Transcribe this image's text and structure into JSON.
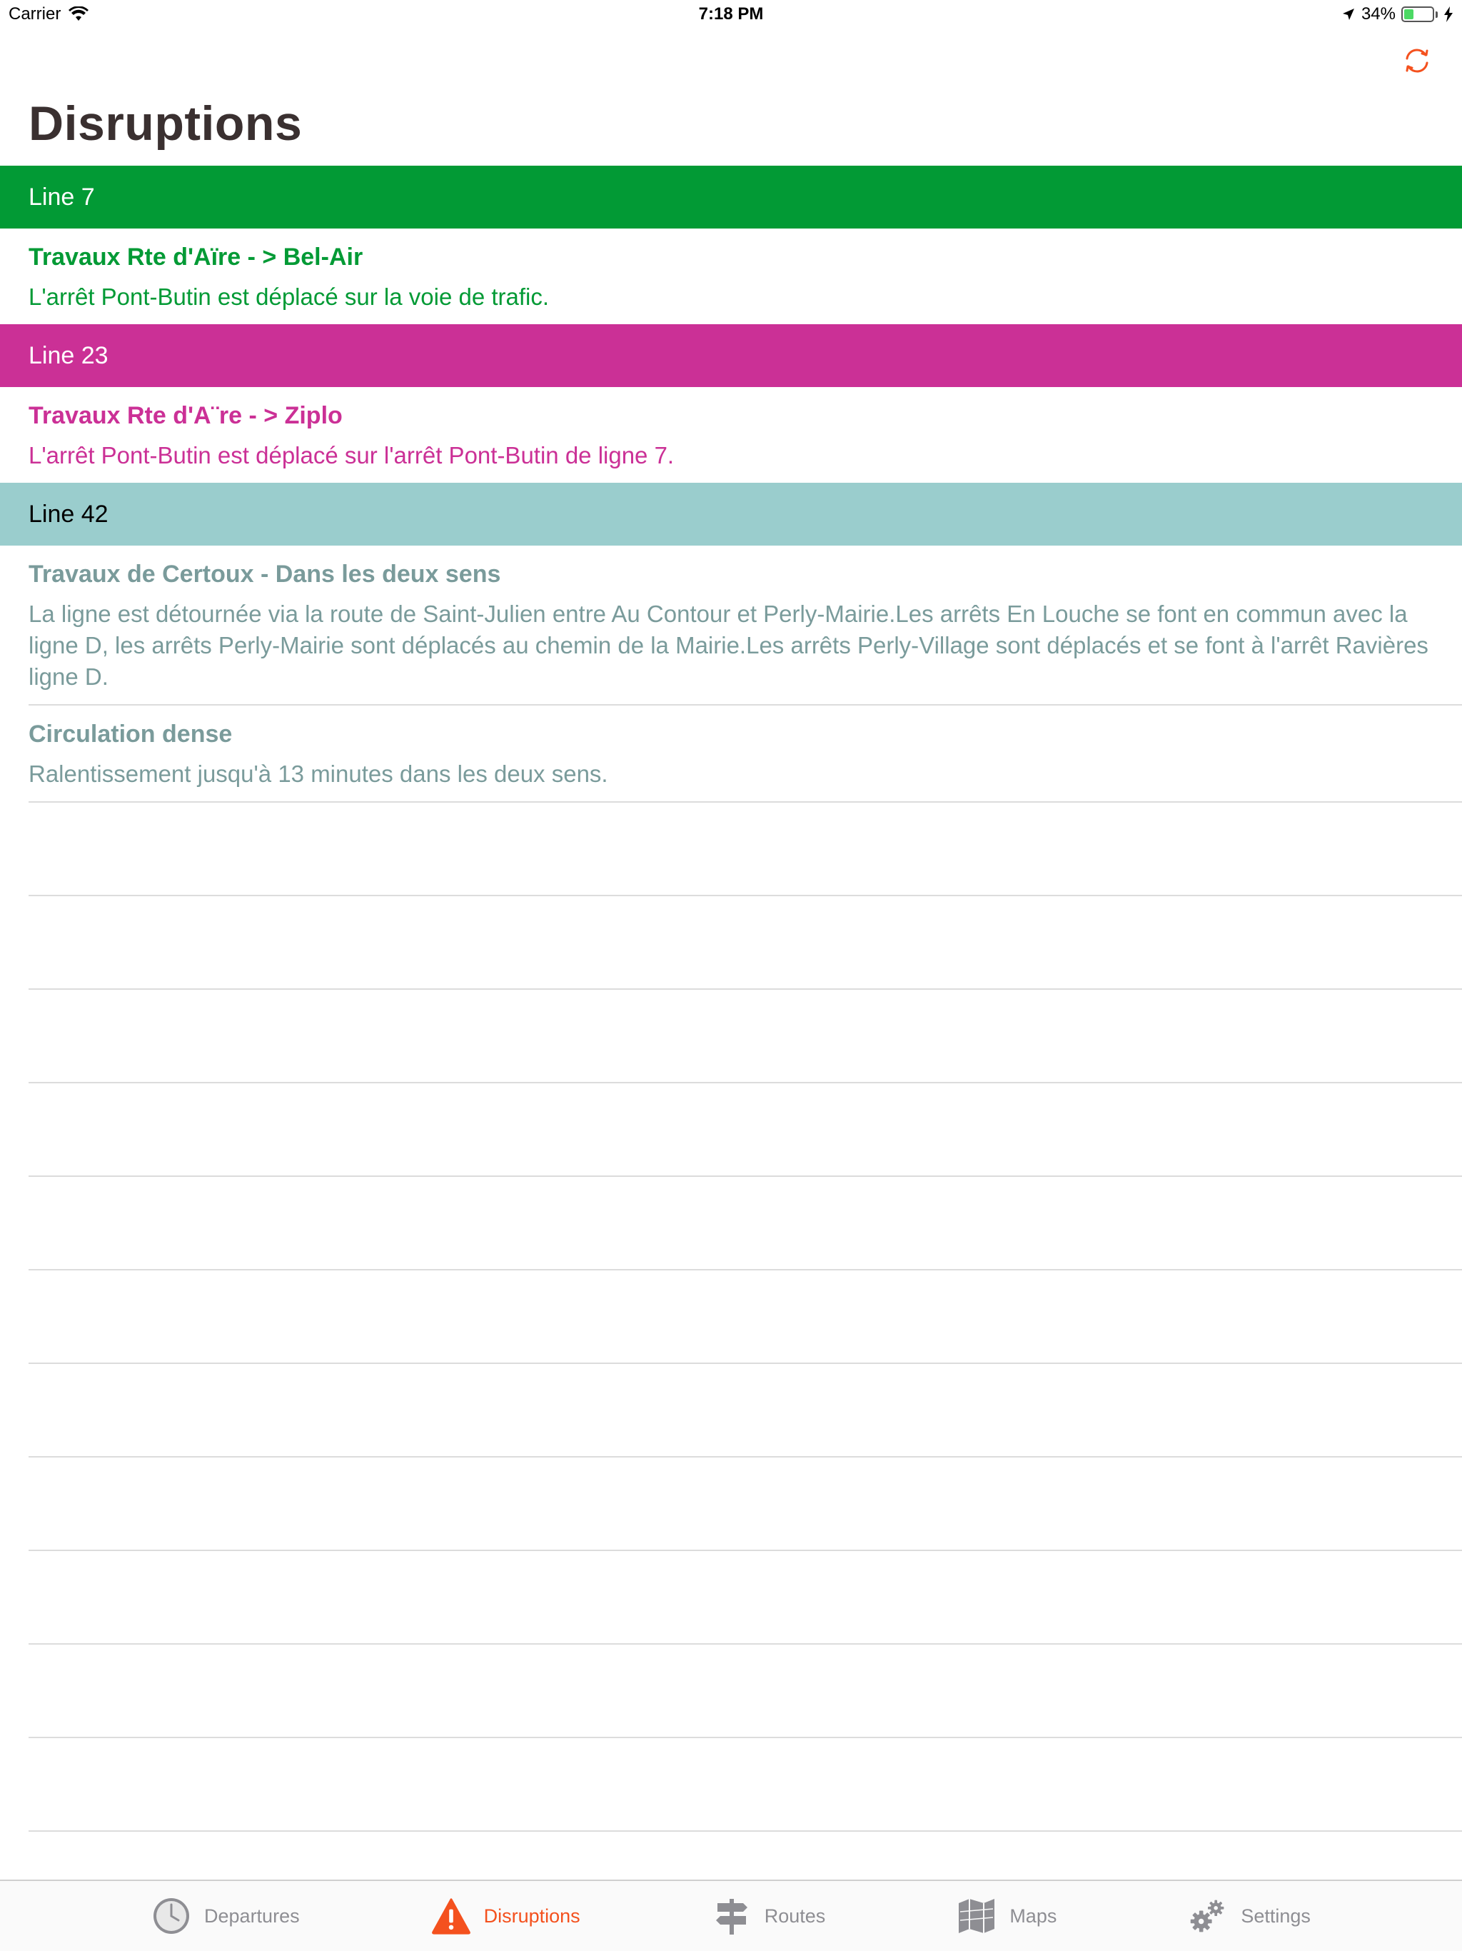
{
  "status_bar": {
    "carrier": "Carrier",
    "time": "7:18 PM",
    "battery": "34%",
    "battery_level": 0.34
  },
  "nav": {
    "title": "Disruptions",
    "accent_color": "#f4511e"
  },
  "sections": [
    {
      "line": "Line 7",
      "header_bg": "#029A35",
      "header_fg": "#ffffff",
      "text_color": "#029A35",
      "items": [
        {
          "title": "Travaux Rte d'Aïre - > Bel-Air",
          "body": "L'arrêt Pont-Butin est déplacé sur la voie de trafic."
        }
      ]
    },
    {
      "line": "Line 23",
      "header_bg": "#CB3096",
      "header_fg": "#ffffff",
      "text_color": "#CB3096",
      "items": [
        {
          "title": "Travaux Rte d'A¨re - > Ziplo",
          "body": "L'arrêt Pont-Butin est déplacé sur l'arrêt Pont-Butin de ligne 7."
        }
      ]
    },
    {
      "line": "Line 42",
      "header_bg": "#9ACDCD",
      "header_fg": "#000000",
      "text_color": "#7A9B9B",
      "items": [
        {
          "title": "Travaux de Certoux - Dans les deux sens",
          "body": "La ligne est détournée via la route de Saint-Julien entre Au Contour et Perly-Mairie.Les arrêts En Louche se font en commun avec la ligne D, les arrêts Perly-Mairie sont déplacés au chemin de la Mairie.Les arrêts Perly-Village sont déplacés et se font à l'arrêt Ravières ligne D."
        },
        {
          "title": "Circulation dense",
          "body": "Ralentissement jusqu'à 13 minutes dans les deux sens."
        }
      ]
    }
  ],
  "tabs": [
    {
      "label": "Departures",
      "icon": "clock-icon",
      "active": false
    },
    {
      "label": "Disruptions",
      "icon": "warning-icon",
      "active": true
    },
    {
      "label": "Routes",
      "icon": "signpost-icon",
      "active": false
    },
    {
      "label": "Maps",
      "icon": "map-icon",
      "active": false
    },
    {
      "label": "Settings",
      "icon": "gear-icon",
      "active": false
    }
  ]
}
